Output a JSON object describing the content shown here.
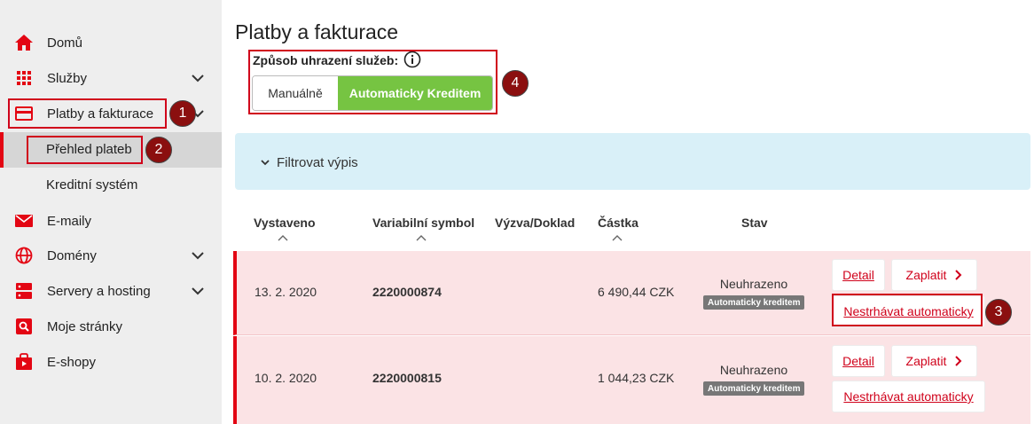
{
  "sidebar": {
    "items": [
      {
        "label": "Domů",
        "icon": "home-icon"
      },
      {
        "label": "Služby",
        "icon": "grid-icon"
      },
      {
        "label": "Platby a fakturace",
        "icon": "credit-card-icon"
      },
      {
        "label": "E-maily",
        "icon": "envelope-icon"
      },
      {
        "label": "Domény",
        "icon": "globe-icon"
      },
      {
        "label": "Servery a hosting",
        "icon": "server-icon"
      },
      {
        "label": "Moje stránky",
        "icon": "search-page-icon"
      },
      {
        "label": "E-shopy",
        "icon": "shopping-bag-icon"
      }
    ],
    "sub_items": [
      {
        "label": "Přehled plateb"
      },
      {
        "label": "Kreditní systém"
      }
    ]
  },
  "annotations": {
    "badge1": "1",
    "badge2": "2",
    "badge3": "3",
    "badge4": "4"
  },
  "main": {
    "title": "Platby a fakturace",
    "payment_method_label": "Způsob uhrazení služeb:",
    "toggle": {
      "manual": "Manuálně",
      "auto": "Automaticky Kreditem"
    },
    "filter_label": "Filtrovat výpis",
    "table": {
      "headers": [
        "Vystaveno",
        "Variabilní symbol",
        "Výzva/Doklad",
        "Částka",
        "Stav"
      ],
      "rows": [
        {
          "date": "13. 2. 2020",
          "symbol": "2220000874",
          "amount": "6 490,44 CZK",
          "status": "Neuhrazeno",
          "tag": "Automaticky kreditem",
          "detail": "Detail",
          "pay": "Zaplatit",
          "stop": "Nestrhávat automaticky"
        },
        {
          "date": "10. 2. 2020",
          "symbol": "2220000815",
          "amount": "1 044,23 CZK",
          "status": "Neuhrazeno",
          "tag": "Automaticky kreditem",
          "detail": "Detail",
          "pay": "Zaplatit",
          "stop": "Nestrhávat automaticky"
        }
      ]
    }
  },
  "colors": {
    "accent": "#e30613",
    "green": "#76c442",
    "filter_bg": "#d9f0f8",
    "row_bg": "#fbe3e5"
  }
}
